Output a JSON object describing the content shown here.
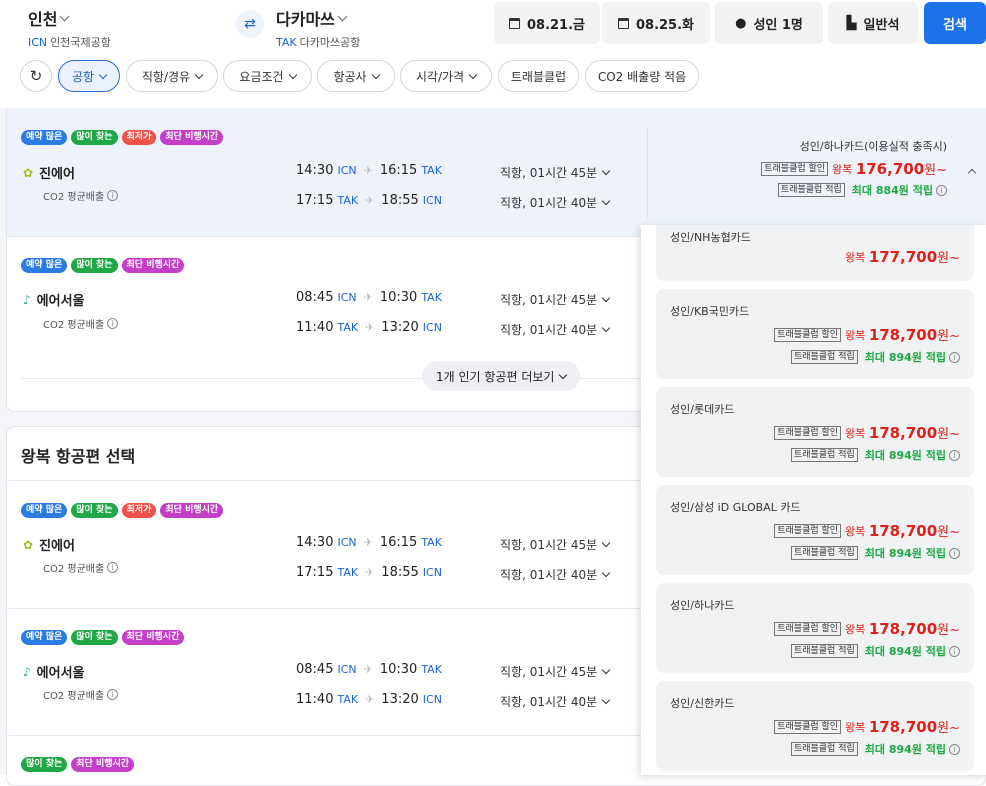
{
  "header": {
    "origin": {
      "name": "인천",
      "code": "ICN",
      "airport": "인천국제공항"
    },
    "dest": {
      "name": "다카마쓰",
      "code": "TAK",
      "airport": "다카마쓰공항"
    },
    "date1": "08.21.금",
    "date2": "08.25.화",
    "pax": "성인 1명",
    "cabin": "일반석",
    "search": "검색"
  },
  "filters": [
    "공항",
    "직항/경유",
    "요금조건",
    "항공사",
    "시각/가격",
    "트래블클럽",
    "CO2 배출량 적음"
  ],
  "badge_labels": {
    "b1": "예약 많은",
    "b2": "많이 찾는",
    "b3": "최저가",
    "b4": "최단 비행시간"
  },
  "common": {
    "co2": "CO2 평균배출",
    "info": "i",
    "plane": "✈",
    "label_disc": "트래블클럽 할인",
    "label_pts": "트래블클럽 적립",
    "round": "왕복"
  },
  "flights": {
    "jin": {
      "airline": "진에어",
      "seg1": {
        "dep": "14:30",
        "from": "ICN",
        "arr": "16:15",
        "to": "TAK",
        "dur": "직항, 01시간 45분"
      },
      "seg2": {
        "dep": "17:15",
        "from": "TAK",
        "arr": "18:55",
        "to": "ICN",
        "dur": "직항, 01시간 40분"
      }
    },
    "seoul": {
      "airline": "에어서울",
      "seg1": {
        "dep": "08:45",
        "from": "ICN",
        "arr": "10:30",
        "to": "TAK",
        "dur": "직항, 01시간 45분"
      },
      "seg2": {
        "dep": "11:40",
        "from": "TAK",
        "arr": "13:20",
        "to": "ICN",
        "dur": "직항, 01시간 40분"
      }
    }
  },
  "first_price": {
    "card": "성인/하나카드(이용실적 충족시)",
    "price": "176,700",
    "won": "원~",
    "points": "최대 884원 적립"
  },
  "more_btn": "1개 인기 항공편 더보기",
  "section_title": "왕복 항공편 선택",
  "options": [
    {
      "card": "성인/NH농협카드",
      "price": "177,700",
      "won": "원~"
    },
    {
      "card": "성인/KB국민카드",
      "price": "178,700",
      "won": "원~",
      "points": "최대 894원 적립"
    },
    {
      "card": "성인/롯데카드",
      "price": "178,700",
      "won": "원~",
      "points": "최대 894원 적립"
    },
    {
      "card": "성인/삼성 iD GLOBAL 카드",
      "price": "178,700",
      "won": "원~",
      "points": "최대 894원 적립"
    },
    {
      "card": "성인/하나카드",
      "price": "178,700",
      "won": "원~",
      "points": "최대 894원 적립"
    },
    {
      "card": "성인/신한카드",
      "price": "178,700",
      "won": "원~",
      "points": "최대 894원 적립"
    }
  ],
  "colors": {
    "blue": "#2a7be4",
    "green": "#1fa845",
    "red": "#f0524a",
    "purple": "#c43ec8"
  }
}
